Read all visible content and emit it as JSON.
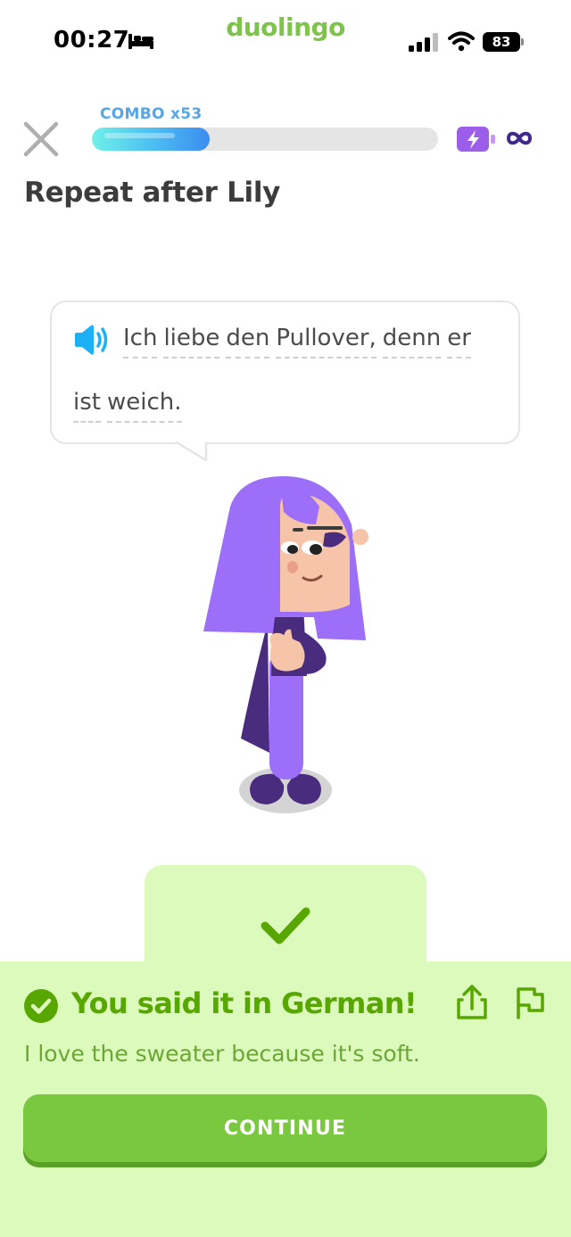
{
  "status_bar": {
    "time": "00:27",
    "brand": "duolingo",
    "battery": "83"
  },
  "lesson": {
    "combo": "COMBO x53",
    "progress_fraction": 0.34,
    "energy": "∞",
    "instruction": "Repeat after Lily"
  },
  "prompt": {
    "line1_words": [
      "Ich",
      "liebe",
      "den",
      "Pullover,",
      "denn",
      "er"
    ],
    "line2_words": [
      "ist",
      "weich."
    ]
  },
  "result": {
    "title": "You said it in German!",
    "translation": "I love the sweater because it's soft.",
    "continue_label": "CONTINUE"
  },
  "colors": {
    "success_green": "#58a700",
    "panel_bg": "#dcfabb",
    "button_green": "#7ac740",
    "character_purple": "#9d6ef7"
  }
}
